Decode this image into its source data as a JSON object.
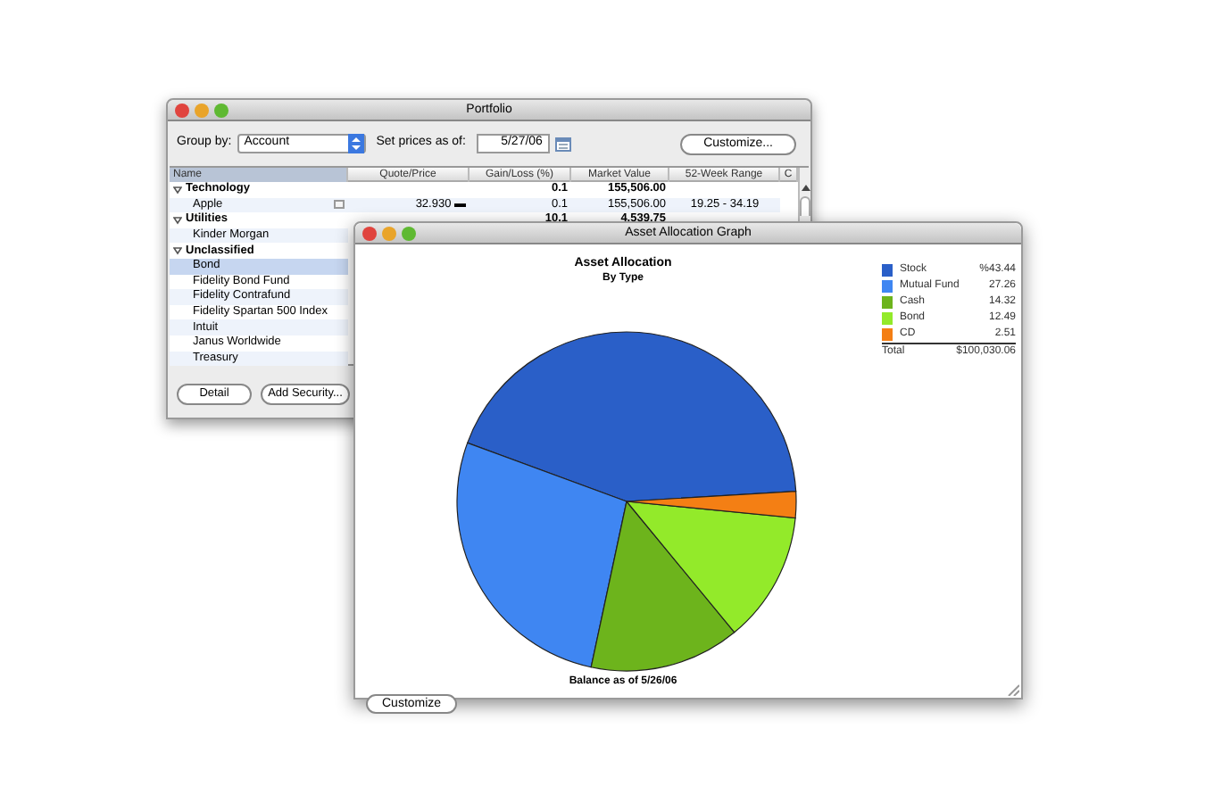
{
  "portfolio_window": {
    "title": "Portfolio",
    "group_by": {
      "label": "Group by:",
      "value": "Account"
    },
    "prices_as_of": {
      "label": "Set prices as of:",
      "value": "5/27/06"
    },
    "customize_button": "Customize...",
    "table": {
      "columns": [
        "Name",
        "Quote/Price",
        "Gain/Loss (%)",
        "Market Value",
        "52-Week Range",
        "C"
      ],
      "rows": [
        {
          "kind": "group",
          "expanded": true,
          "selected": false,
          "cells": [
            "Technology",
            "",
            "0.1",
            "155,506.00",
            ""
          ]
        },
        {
          "kind": "item",
          "selected": false,
          "cells": [
            "Apple",
            "32.930 ▬",
            "0.1",
            "155,506.00",
            "19.25 - 34.19"
          ]
        },
        {
          "kind": "group",
          "expanded": true,
          "selected": false,
          "cells": [
            "Utilities",
            "",
            "10.1",
            "4,539.75",
            ""
          ]
        },
        {
          "kind": "item",
          "selected": false,
          "cells": [
            "Kinder Morgan"
          ]
        },
        {
          "kind": "group",
          "expanded": true,
          "selected": false,
          "cells": [
            "Unclassified"
          ]
        },
        {
          "kind": "item",
          "selected": true,
          "cells": [
            "Bond"
          ]
        },
        {
          "kind": "item",
          "selected": false,
          "cells": [
            "Fidelity Bond Fund"
          ]
        },
        {
          "kind": "item",
          "selected": false,
          "cells": [
            "Fidelity Contrafund"
          ]
        },
        {
          "kind": "item",
          "selected": false,
          "cells": [
            "Fidelity Spartan 500 Index"
          ]
        },
        {
          "kind": "item",
          "selected": false,
          "cells": [
            "Intuit"
          ]
        },
        {
          "kind": "item",
          "selected": false,
          "cells": [
            "Janus Worldwide"
          ]
        },
        {
          "kind": "item",
          "selected": false,
          "cells": [
            "Treasury"
          ]
        }
      ]
    },
    "buttons": [
      "Detail",
      "Add Security..."
    ]
  },
  "graph_window": {
    "title": "Asset Allocation Graph",
    "chart_data": {
      "type": "pie",
      "title": "Asset Allocation",
      "categories": [
        "Stock",
        "Mutual Fund",
        "Cash",
        "Bond",
        "CD"
      ],
      "values": [
        43.44,
        27.26,
        14.32,
        12.49,
        2.51
      ]
    },
    "subtitle": "By Type",
    "legend": [
      {
        "value": "%43.44",
        "color": "#2a5fc8"
      },
      {
        "value": "27.26",
        "color": "#3f86f2"
      },
      {
        "value": "14.32",
        "color": "#6db41c"
      },
      {
        "value": "12.49",
        "color": "#93ea2a"
      },
      {
        "value": "2.51",
        "color": "#f47f14"
      }
    ],
    "total": {
      "label": "Total",
      "value": "$100,030.06"
    },
    "footer": "Balance as of 5/26/06",
    "customize_button": "Customize"
  }
}
